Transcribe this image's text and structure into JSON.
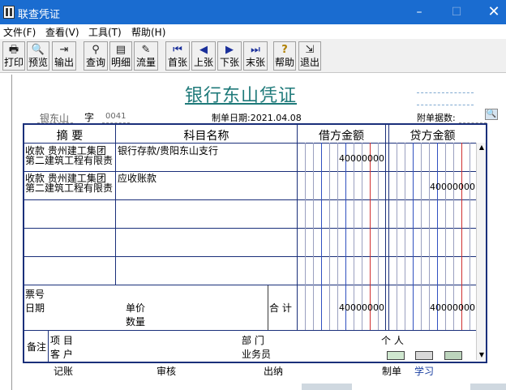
{
  "window": {
    "title": "联查凭证",
    "minimize_glyph": "–",
    "maximize_glyph": "☐",
    "close_glyph": "✕"
  },
  "menu": [
    {
      "label": "文件(F)"
    },
    {
      "label": "查看(V)"
    },
    {
      "label": "工具(T)"
    },
    {
      "label": "帮助(H)"
    }
  ],
  "toolbar": [
    {
      "label": "打印",
      "icon": "printer-icon",
      "glyph": "🖶"
    },
    {
      "label": "预览",
      "icon": "preview-icon",
      "glyph": "🔍"
    },
    {
      "label": "输出",
      "icon": "export-icon",
      "glyph": "⇥"
    },
    {
      "label": "查询",
      "icon": "binoculars-icon",
      "glyph": "⚲"
    },
    {
      "label": "明细",
      "icon": "detail-icon",
      "glyph": "▤"
    },
    {
      "label": "流量",
      "icon": "cashflow-icon",
      "glyph": "✎"
    },
    {
      "label": "首张",
      "icon": "first-icon",
      "glyph": "⏮"
    },
    {
      "label": "上张",
      "icon": "prev-icon",
      "glyph": "◀"
    },
    {
      "label": "下张",
      "icon": "next-icon",
      "glyph": "▶"
    },
    {
      "label": "末张",
      "icon": "last-icon",
      "glyph": "⏭"
    },
    {
      "label": "帮助",
      "icon": "help-icon",
      "glyph": "?"
    },
    {
      "label": "退出",
      "icon": "exit-icon",
      "glyph": "⇲"
    }
  ],
  "voucher": {
    "title": "银行东山凭证",
    "type_label": "银东山",
    "zi_label": "字",
    "number": "0041",
    "date_label": "制单日期:2021.04.08",
    "attachments_label": "附单据数:",
    "headers": {
      "summary": "摘 要",
      "account": "科目名称",
      "debit": "借方金额",
      "credit": "贷方金额"
    },
    "rows": [
      {
        "summary": "收款 贵州建工集团\n第二建筑工程有限责",
        "account": "银行存款/贵阳东山支行",
        "debit": "40000000",
        "credit": ""
      },
      {
        "summary": "收款 贵州建工集团\n第二建筑工程有限责",
        "account": "应收账款",
        "debit": "",
        "credit": "40000000"
      },
      {
        "summary": "",
        "account": "",
        "debit": "",
        "credit": ""
      },
      {
        "summary": "",
        "account": "",
        "debit": "",
        "credit": ""
      },
      {
        "summary": "",
        "account": "",
        "debit": "",
        "credit": ""
      }
    ],
    "bottom": {
      "ticket_no_label": "票号",
      "date_label": "日期",
      "unit_price_label": "单价",
      "quantity_label": "数量",
      "total_label": "合 计",
      "total_debit": "40000000",
      "total_credit": "40000000"
    },
    "remarks": {
      "label": "备注",
      "project_label": "项 目",
      "customer_label": "客 户",
      "department_label": "部 门",
      "salesperson_label": "业务员",
      "individual_label": "个 人"
    },
    "footer": {
      "bookkeeper_label": "记账",
      "reviewer_label": "审核",
      "cashier_label": "出纳",
      "preparer_label": "制单",
      "preparer_name": "学习"
    }
  },
  "colors": {
    "titlebar": "#1a6cd0",
    "voucher_title": "#1f7a7a",
    "table_border": "#1a2f7a",
    "preparer_name": "#1a3fa0"
  }
}
